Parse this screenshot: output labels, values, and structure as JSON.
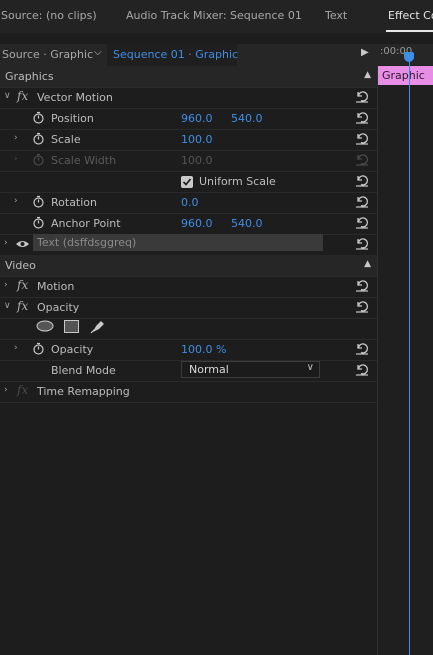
{
  "tabs": [
    {
      "label": "Source: (no clips)"
    },
    {
      "label": "Audio Track Mixer: Sequence 01"
    },
    {
      "label": "Text"
    },
    {
      "label": "Effect Co"
    }
  ],
  "source_bar": {
    "source_label": "Source · Graphic",
    "sequence_label": "Sequence 01 · Graphic"
  },
  "timeline": {
    "timecode": ":00:00",
    "clip_label": "Graphic"
  },
  "sections": {
    "graphics": "Graphics",
    "video": "Video"
  },
  "vector_motion": {
    "label": "Vector Motion",
    "position": {
      "label": "Position",
      "x": "960.0",
      "y": "540.0"
    },
    "scale": {
      "label": "Scale",
      "value": "100.0"
    },
    "scale_width": {
      "label": "Scale Width",
      "value": "100.0"
    },
    "uniform_scale": {
      "label": "Uniform Scale",
      "checked": true
    },
    "rotation": {
      "label": "Rotation",
      "value": "0.0"
    },
    "anchor_point": {
      "label": "Anchor Point",
      "x": "960.0",
      "y": "540.0"
    }
  },
  "text_layer": {
    "label": "Text (dsffdsggreq)"
  },
  "motion": {
    "label": "Motion"
  },
  "opacity": {
    "label": "Opacity",
    "opacity_prop": {
      "label": "Opacity",
      "value": "100.0 %"
    },
    "blend_mode": {
      "label": "Blend Mode",
      "value": "Normal"
    }
  },
  "time_remapping": {
    "label": "Time Remapping"
  },
  "colors": {
    "accent_blue": "#3f8ee6",
    "clip_pink": "#e98ee6",
    "background": "#1d1d1d"
  }
}
